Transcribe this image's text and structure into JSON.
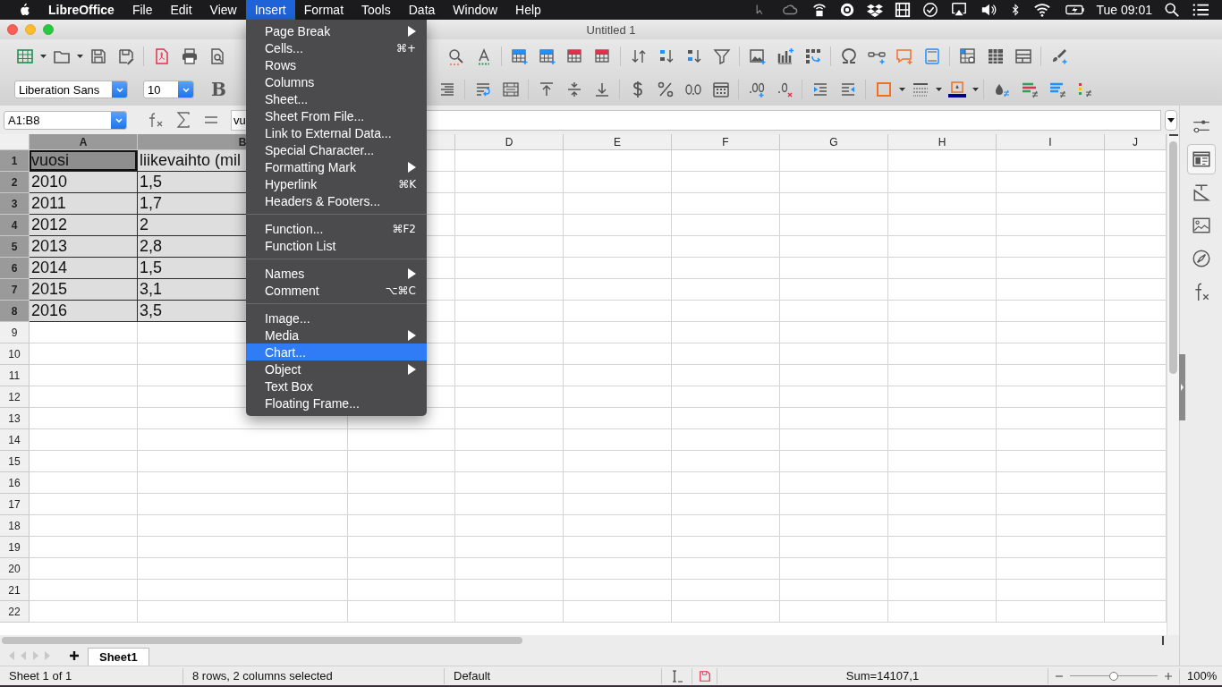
{
  "menubar": {
    "app": "LibreOffice",
    "menus": [
      {
        "label": "File",
        "selected": false
      },
      {
        "label": "Edit",
        "selected": false
      },
      {
        "label": "View",
        "selected": false
      },
      {
        "label": "Insert",
        "selected": true
      },
      {
        "label": "Format",
        "selected": false
      },
      {
        "label": "Tools",
        "selected": false
      },
      {
        "label": "Data",
        "selected": false
      },
      {
        "label": "Window",
        "selected": false
      },
      {
        "label": "Help",
        "selected": false
      }
    ],
    "clock": "Tue 09:01"
  },
  "window": {
    "title": "Untitled 1"
  },
  "toolbar": {
    "font_name": "Liberation Sans",
    "font_size": "10",
    "bold_label": "B"
  },
  "formula_bar": {
    "name_box": "A1:B8",
    "input": "vu"
  },
  "grid": {
    "columns": [
      {
        "label": "A",
        "selected": true
      },
      {
        "label": "B",
        "selected": true
      },
      {
        "selected": false
      },
      {
        "label": "D",
        "selected": false
      },
      {
        "label": "E",
        "selected": false
      },
      {
        "label": "F",
        "selected": false
      },
      {
        "label": "G",
        "selected": false
      },
      {
        "label": "H",
        "selected": false
      },
      {
        "label": "I",
        "selected": false
      },
      {
        "label": "J",
        "selected": false
      }
    ],
    "rows": [
      {
        "label": "1",
        "selected": true,
        "cells": [
          {
            "text": "vuosi",
            "active": true
          },
          {
            "text": "liikevaihto (mil",
            "active": false
          }
        ]
      },
      {
        "label": "2",
        "selected": true,
        "cells": [
          {
            "text": "2010",
            "active": false
          },
          {
            "text": "1,5",
            "active": false
          }
        ]
      },
      {
        "label": "3",
        "selected": true,
        "cells": [
          {
            "text": "2011",
            "active": false
          },
          {
            "text": "1,7",
            "active": false
          }
        ]
      },
      {
        "label": "4",
        "selected": true,
        "cells": [
          {
            "text": "2012",
            "active": false
          },
          {
            "text": "2",
            "active": false
          }
        ]
      },
      {
        "label": "5",
        "selected": true,
        "cells": [
          {
            "text": "2013",
            "active": false
          },
          {
            "text": "2,8",
            "active": false
          }
        ]
      },
      {
        "label": "6",
        "selected": true,
        "cells": [
          {
            "text": "2014",
            "active": false
          },
          {
            "text": "1,5",
            "active": false
          }
        ]
      },
      {
        "label": "7",
        "selected": true,
        "cells": [
          {
            "text": "2015",
            "active": false
          },
          {
            "text": "3,1",
            "active": false
          }
        ]
      },
      {
        "label": "8",
        "selected": true,
        "cells": [
          {
            "text": "2016",
            "active": false
          },
          {
            "text": "3,5",
            "active": false
          }
        ]
      },
      {
        "label": "9",
        "selected": false
      },
      {
        "label": "10",
        "selected": false
      },
      {
        "label": "11",
        "selected": false
      },
      {
        "label": "12",
        "selected": false
      },
      {
        "label": "13",
        "selected": false
      },
      {
        "label": "14",
        "selected": false
      },
      {
        "label": "15",
        "selected": false
      },
      {
        "label": "16",
        "selected": false
      },
      {
        "label": "17",
        "selected": false
      },
      {
        "label": "18",
        "selected": false
      },
      {
        "label": "19",
        "selected": false
      },
      {
        "label": "20",
        "selected": false
      },
      {
        "label": "21",
        "selected": false
      },
      {
        "label": "22",
        "selected": false
      }
    ]
  },
  "insert_menu": {
    "groups": [
      [
        {
          "label": "Page Break",
          "submenu": true,
          "selected": false
        },
        {
          "label": "Cells...",
          "shortcut": "⌘+",
          "submenu": false,
          "selected": false
        },
        {
          "label": "Rows",
          "submenu": false,
          "selected": false
        },
        {
          "label": "Columns",
          "submenu": false,
          "selected": false
        },
        {
          "label": "Sheet...",
          "submenu": false,
          "selected": false
        },
        {
          "label": "Sheet From File...",
          "submenu": false,
          "selected": false
        },
        {
          "label": "Link to External Data...",
          "submenu": false,
          "selected": false
        },
        {
          "label": "Special Character...",
          "submenu": false,
          "selected": false
        },
        {
          "label": "Formatting Mark",
          "submenu": true,
          "selected": false
        },
        {
          "label": "Hyperlink",
          "shortcut": "⌘K",
          "submenu": false,
          "selected": false
        },
        {
          "label": "Headers & Footers...",
          "submenu": false,
          "selected": false
        }
      ],
      [
        {
          "label": "Function...",
          "shortcut": "⌘F2",
          "submenu": false,
          "selected": false
        },
        {
          "label": "Function List",
          "submenu": false,
          "selected": false
        }
      ],
      [
        {
          "label": "Names",
          "submenu": true,
          "selected": false
        },
        {
          "label": "Comment",
          "shortcut": "⌥⌘C",
          "submenu": false,
          "selected": false
        }
      ],
      [
        {
          "label": "Image...",
          "submenu": false,
          "selected": false
        },
        {
          "label": "Media",
          "submenu": true,
          "selected": false
        },
        {
          "label": "Chart...",
          "submenu": false,
          "selected": true
        },
        {
          "label": "Object",
          "submenu": true,
          "selected": false
        },
        {
          "label": "Text Box",
          "submenu": false,
          "selected": false
        },
        {
          "label": "Floating Frame...",
          "submenu": false,
          "selected": false
        }
      ]
    ]
  },
  "sidebar": {
    "tabs": [
      {
        "selected": false
      },
      {
        "selected": true
      },
      {
        "selected": false
      },
      {
        "selected": false
      },
      {
        "selected": false
      },
      {
        "selected": false
      }
    ]
  },
  "sheet_tabs": [
    {
      "label": "Sheet1",
      "selected": true
    }
  ],
  "status_bar": {
    "sheet": "Sheet 1 of 1",
    "selection": "8 rows, 2 columns selected",
    "page_style": "Default",
    "sum": "Sum=14107,1",
    "zoom": {
      "level": 0.5,
      "reading": "100%"
    }
  }
}
